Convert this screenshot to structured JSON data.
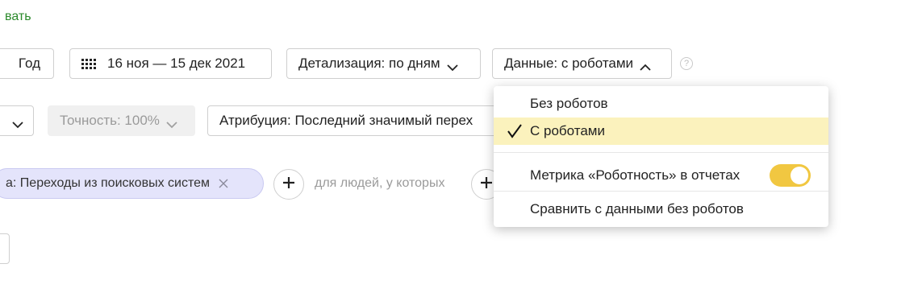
{
  "top": {
    "link_text": "вать"
  },
  "toolbar": {
    "year_label": "Год",
    "date_range": "16 ноя — 15 дек 2021",
    "detail_label": "Детализация: по дням",
    "data_label": "Данные: с роботами",
    "help_glyph": "?"
  },
  "filters": {
    "accuracy_label": "Точность: 100%",
    "attribution_label": "Атрибуция: Последний значимый перех"
  },
  "segment": {
    "chip_label": "а: Переходы из поисковых систем",
    "people_text": "для людей, у которых"
  },
  "dropdown": {
    "items": [
      {
        "label": "Без роботов",
        "checked": false
      },
      {
        "label": "С роботами",
        "checked": true
      }
    ],
    "metric_label": "Метрика «Роботность» в отчетах",
    "metric_toggle_on": true,
    "compare_label": "Сравнить с данными без роботов"
  },
  "colors": {
    "accent_green": "#2b8a2b",
    "highlight": "#fbf2bd",
    "toggle": "#f1c741",
    "chip_bg": "#e4e4fb"
  }
}
